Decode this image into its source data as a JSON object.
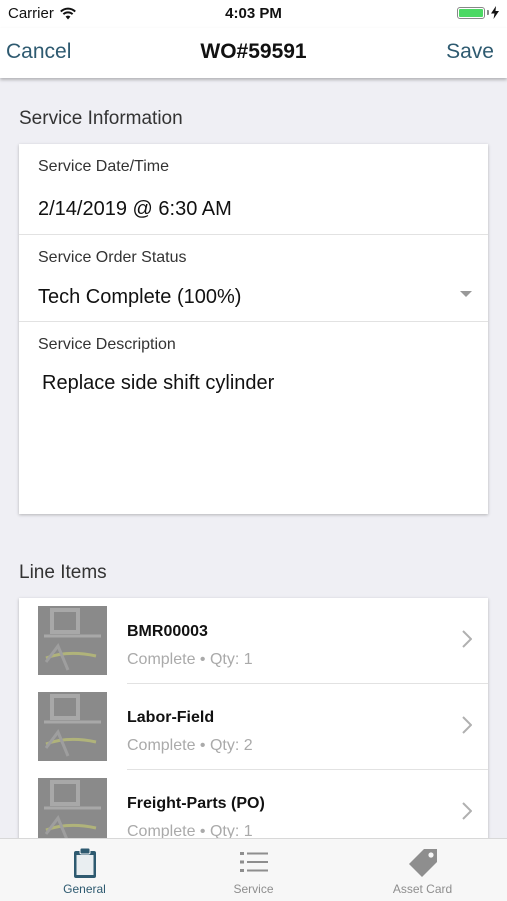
{
  "status_bar": {
    "carrier": "Carrier",
    "time": "4:03 PM"
  },
  "nav": {
    "cancel_label": "Cancel",
    "title": "WO#59591",
    "save_label": "Save"
  },
  "service_info": {
    "header": "Service Information",
    "date_label": "Service Date/Time",
    "date_value": "2/14/2019 @ 6:30 AM",
    "status_label": "Service Order Status",
    "status_value": "Tech Complete (100%)",
    "description_label": "Service Description",
    "description_value": "Replace side shift cylinder"
  },
  "line_items": {
    "header": "Line Items",
    "items": [
      {
        "name": "BMR00003",
        "status": "Complete • Qty: 1"
      },
      {
        "name": "Labor-Field",
        "status": "Complete • Qty: 2"
      },
      {
        "name": "Freight-Parts (PO)",
        "status": "Complete • Qty: 1"
      }
    ]
  },
  "tabs": [
    {
      "label": "General",
      "icon": "clipboard-icon",
      "active": true
    },
    {
      "label": "Service",
      "icon": "list-icon",
      "active": false
    },
    {
      "label": "Asset Card",
      "icon": "tag-icon",
      "active": false
    }
  ],
  "colors": {
    "accent": "#2e5a70",
    "inactive": "#8e8e8e",
    "battery": "#4cd964"
  }
}
